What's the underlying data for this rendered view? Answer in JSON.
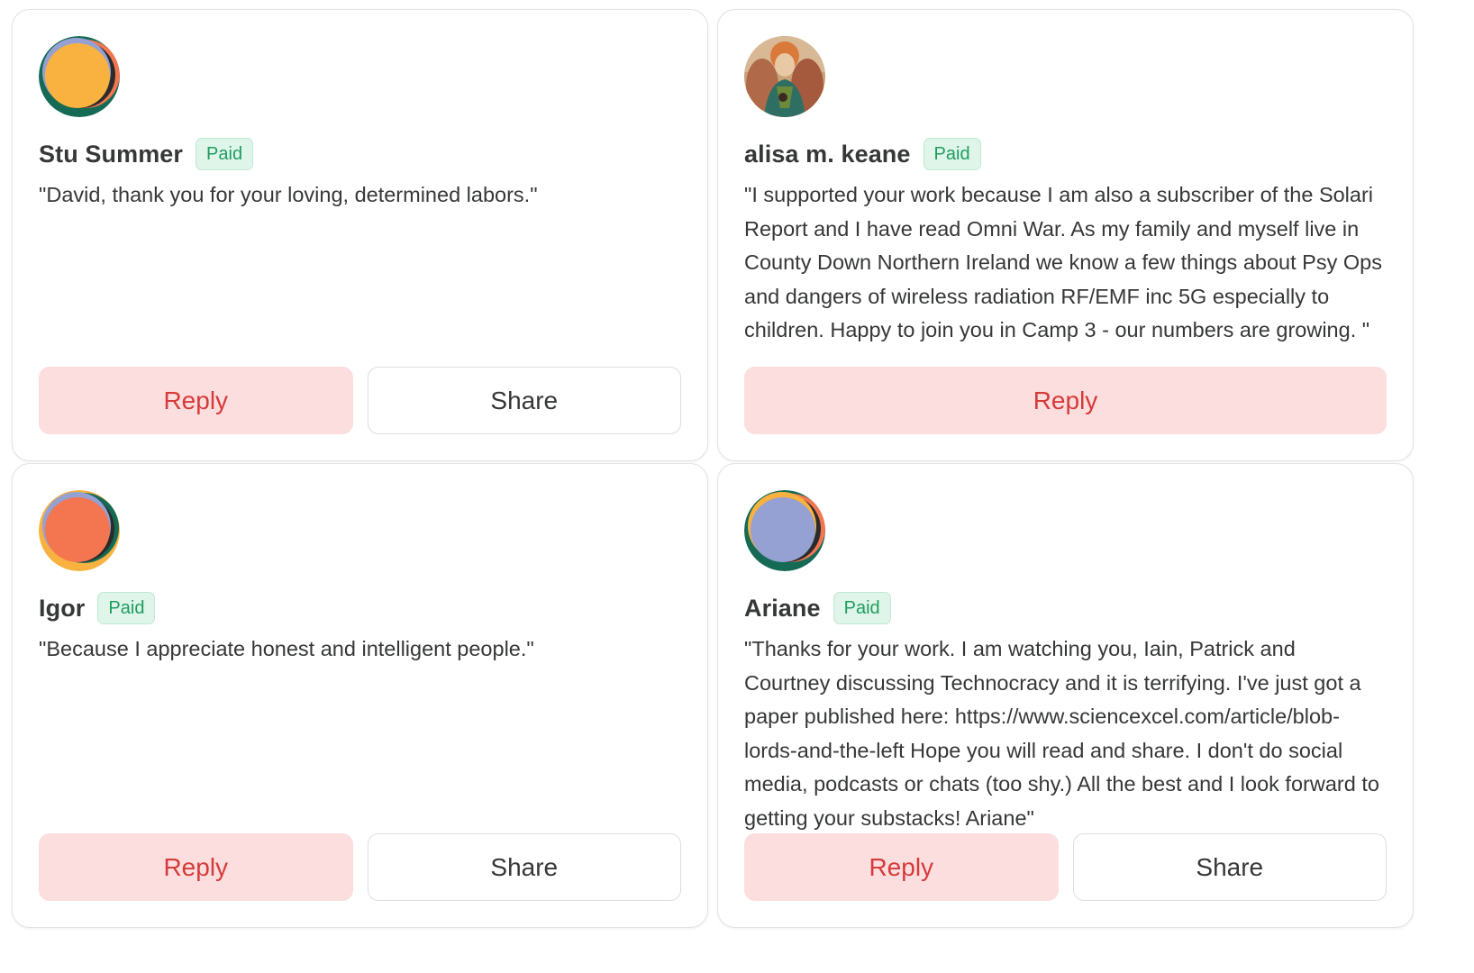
{
  "colors": {
    "paid_text": "#1e9d5e",
    "paid_bg": "#dff5ea",
    "reply_text": "#d63a3a",
    "reply_bg": "#fddede",
    "avatar_orange": "#f9b13f",
    "avatar_red": "#f37650",
    "avatar_blue": "#95a0d3",
    "avatar_green": "#146a55"
  },
  "cards": [
    {
      "name": "Stu Summer",
      "badge": "Paid",
      "avatar": "abstract-orange-avatar",
      "quote": "\"David, thank you for your loving, determined labors.\"",
      "reply_label": "Reply",
      "share_label": "Share"
    },
    {
      "name": "alisa m. keane",
      "badge": "Paid",
      "avatar": "portrait-avatar",
      "quote": "\"I supported your work because I am also a subscriber of the Solari Report and I have read Omni War. As my family and myself live in County Down Northern Ireland we know a few things about Psy Ops and dangers of wireless radiation RF/EMF inc 5G especially to children. Happy to join you in Camp 3 - our numbers are growing. \"",
      "reply_label": "Reply"
    },
    {
      "name": "Igor",
      "badge": "Paid",
      "avatar": "abstract-red-avatar",
      "quote": "\"Because I appreciate honest and intelligent people.\"",
      "reply_label": "Reply",
      "share_label": "Share"
    },
    {
      "name": "Ariane",
      "badge": "Paid",
      "avatar": "abstract-blue-avatar",
      "quote": "\"Thanks for your work. I am watching you, Iain, Patrick and Courtney discussing Technocracy and it is terrifying. I've just got a paper published here: https://www.sciencexcel.com/article/blob-lords-and-the-left Hope you will read and share. I don't do social media, podcasts or chats (too shy.) All the best and I look forward to getting your substacks! Ariane\"",
      "reply_label": "Reply",
      "share_label": "Share"
    }
  ]
}
